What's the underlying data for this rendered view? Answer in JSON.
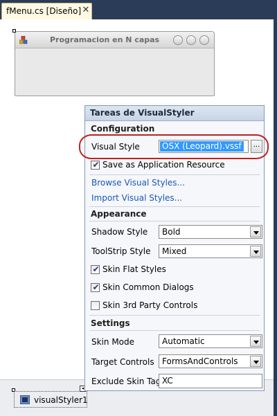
{
  "tab": {
    "title": "fMenu.cs [Diseño]",
    "close_glyph": "✕"
  },
  "form_preview": {
    "title": "Programacion en N capas"
  },
  "tray": {
    "component_name": "visualStyler1",
    "smart_tag_glyph": "◂"
  },
  "panel": {
    "title": "Tareas de VisualStyler",
    "configuration": {
      "heading": "Configuration",
      "visual_style_label": "Visual Style",
      "visual_style_value": "OSX (Leopard).vssf",
      "browse_label": "...",
      "save_resource_label": "Save as Application Resource",
      "save_resource_checked": true,
      "browse_styles_link": "Browse Visual Styles...",
      "import_styles_link": "Import Visual Styles..."
    },
    "appearance": {
      "heading": "Appearance",
      "shadow_style_label": "Shadow Style",
      "shadow_style_value": "Bold",
      "toolstrip_style_label": "ToolStrip Style",
      "toolstrip_style_value": "Mixed",
      "skin_flat_label": "Skin Flat Styles",
      "skin_flat_checked": true,
      "skin_dialogs_label": "Skin Common Dialogs",
      "skin_dialogs_checked": true,
      "skin_3rd_label": "Skin 3rd Party Controls",
      "skin_3rd_checked": false
    },
    "settings": {
      "heading": "Settings",
      "skin_mode_label": "Skin Mode",
      "skin_mode_value": "Automatic",
      "target_controls_label": "Target Controls",
      "target_controls_value": "FormsAndControls",
      "exclude_tag_label": "Exclude Skin Tag",
      "exclude_tag_value": "XC"
    }
  },
  "check_glyph": "✔",
  "colors": {
    "highlight_ring": "#c0201f",
    "selection": "#3399ff",
    "link": "#1a57b8"
  },
  "icons": [
    "close-icon",
    "form-icon",
    "checkmark-icon",
    "dropdown-arrow-icon",
    "component-icon",
    "smart-tag-icon"
  ]
}
